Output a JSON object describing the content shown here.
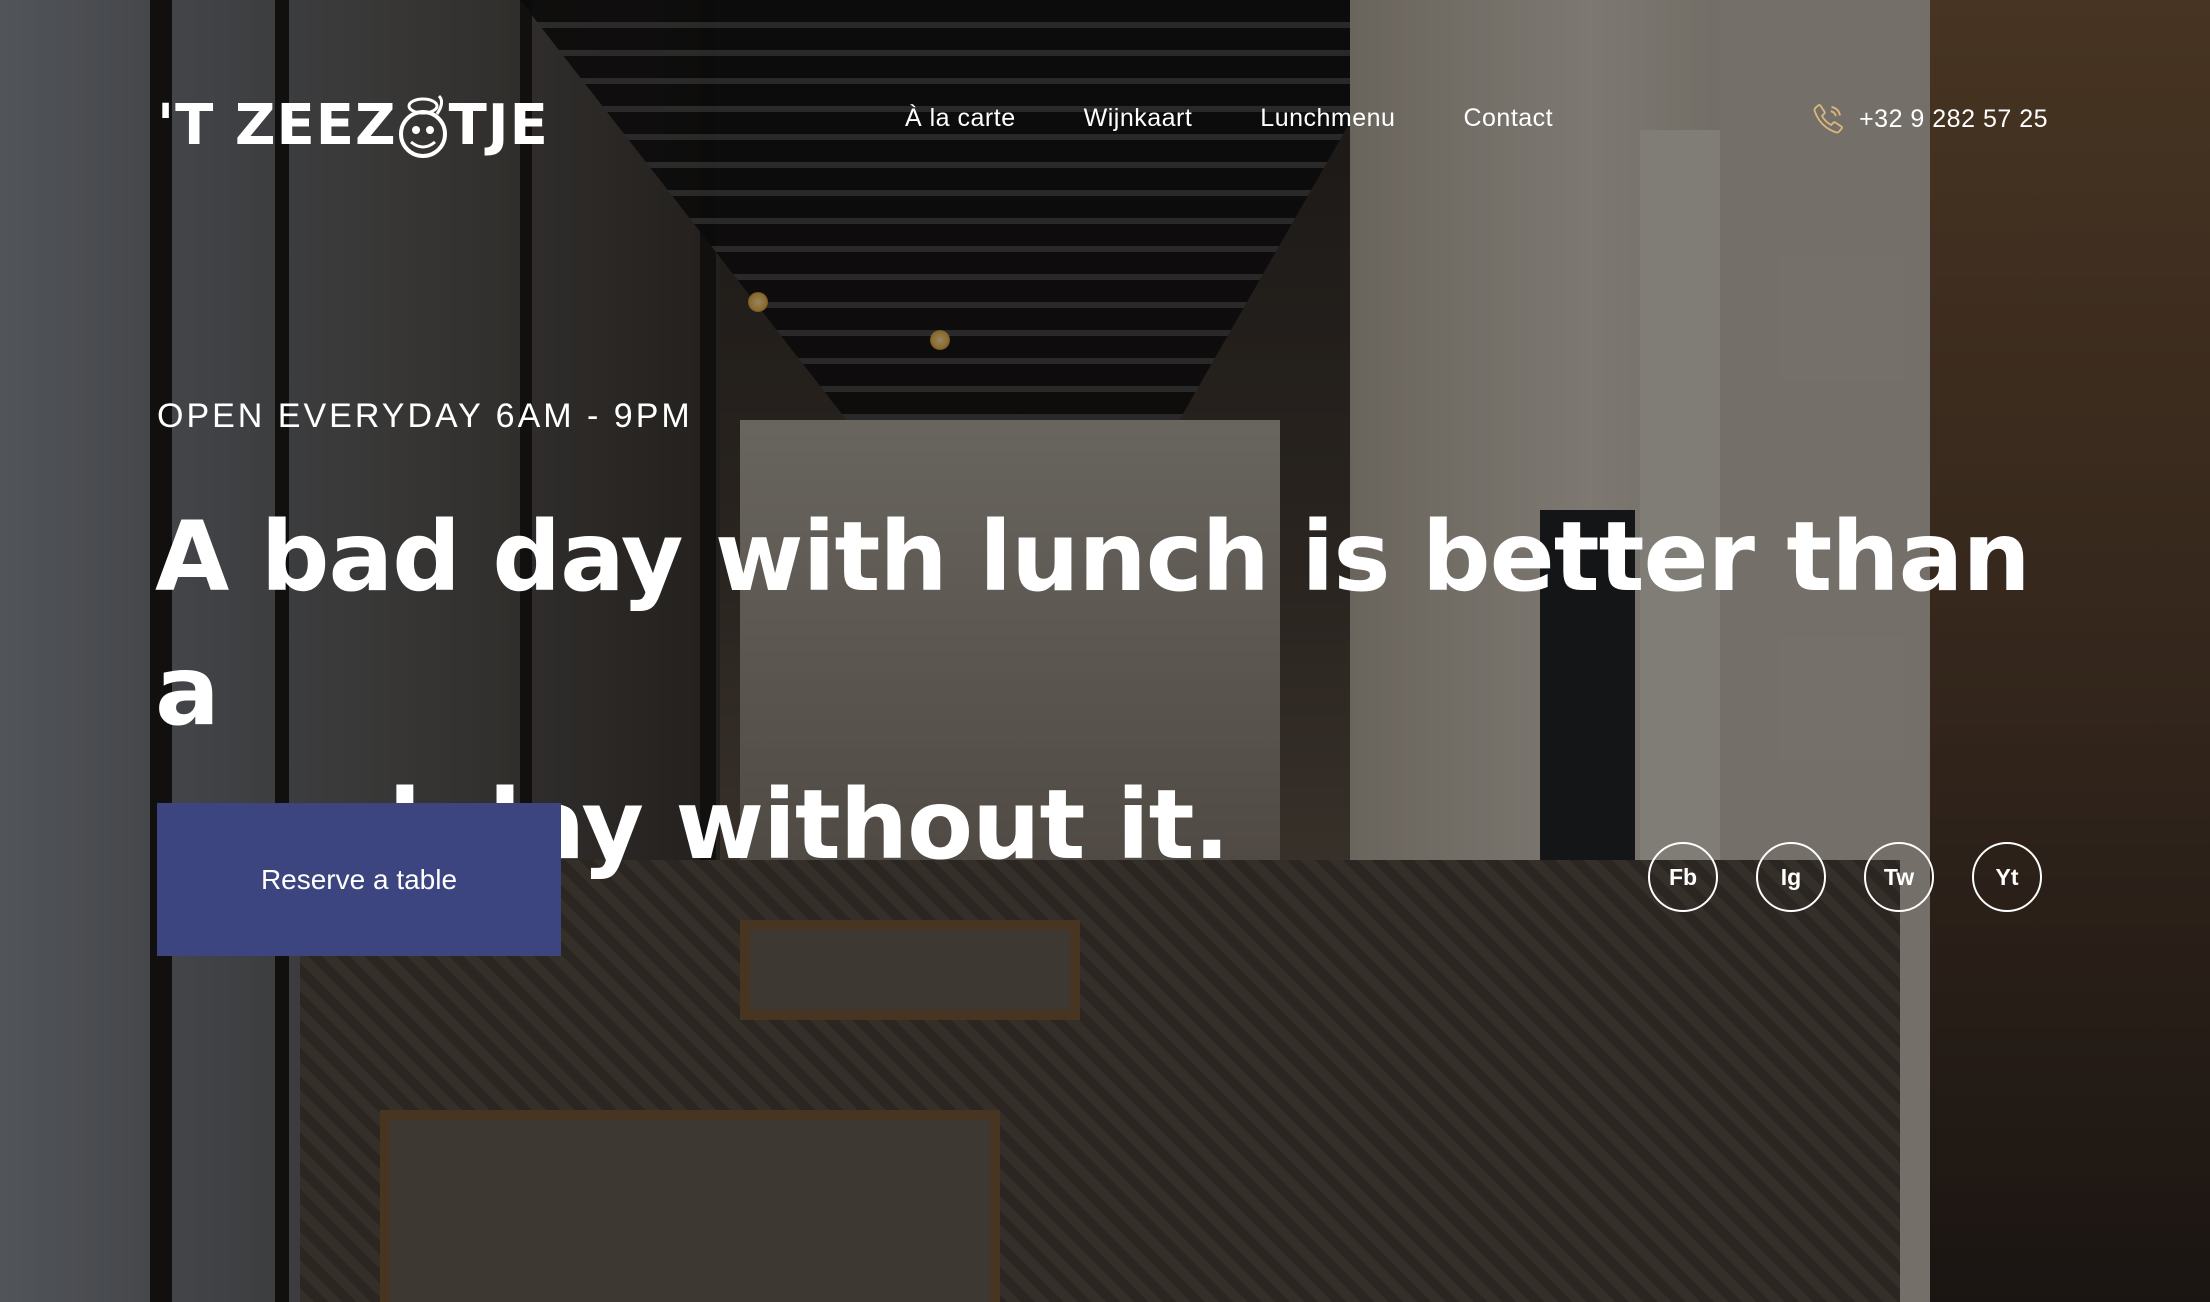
{
  "brand": {
    "logo_text_left": "'T ZEEZ",
    "logo_text_right": "TJE",
    "logo_icon": "sailor-mascot-icon"
  },
  "nav": {
    "items": [
      {
        "label": "À la carte"
      },
      {
        "label": "Wijnkaart"
      },
      {
        "label": "Lunchmenu"
      },
      {
        "label": "Contact"
      }
    ]
  },
  "contact": {
    "phone_icon": "phone-icon",
    "phone": "+32 9 282 57 25",
    "icon_color": "#d9b77a"
  },
  "hero": {
    "eyebrow": "OPEN EVERYDAY 6AM - 9PM",
    "headline_line1": "A bad day with lunch is better than a",
    "headline_line2": "good day without it.",
    "cta_label": "Reserve a table",
    "cta_color": "#3d4580"
  },
  "social": {
    "items": [
      {
        "label": "Fb",
        "icon": "facebook-icon"
      },
      {
        "label": "Ig",
        "icon": "instagram-icon"
      },
      {
        "label": "Tw",
        "icon": "twitter-icon"
      },
      {
        "label": "Yt",
        "icon": "youtube-icon"
      }
    ]
  }
}
